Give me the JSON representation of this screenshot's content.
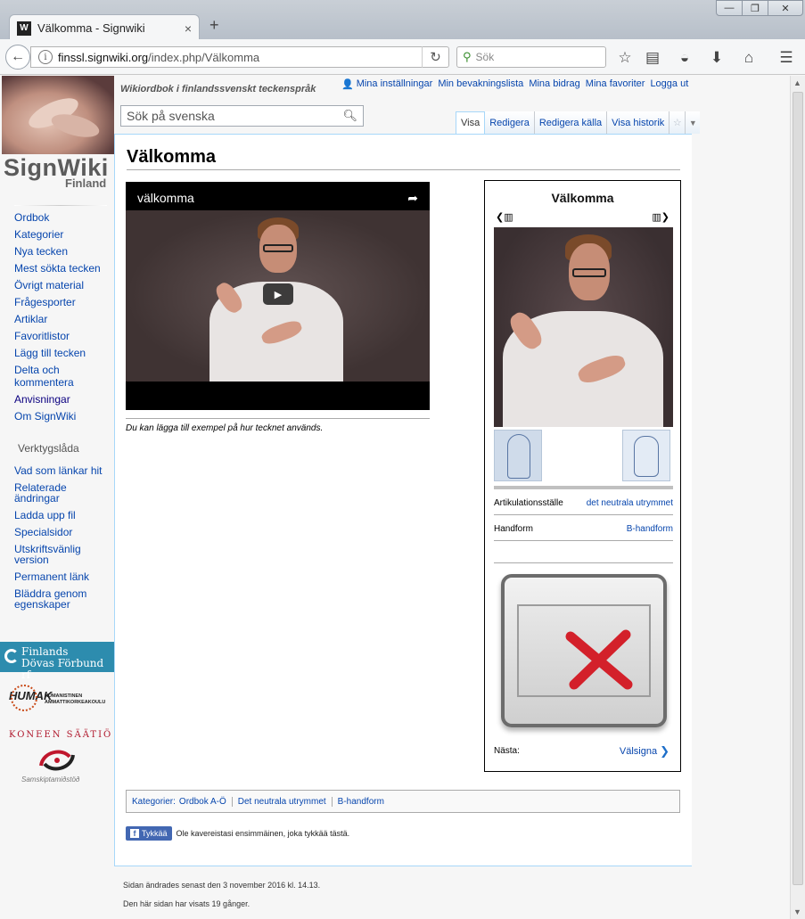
{
  "browser": {
    "tab_title": "Välkomma - Signwiki",
    "tab_close": "×",
    "new_tab": "+",
    "favicon": "W",
    "url_domain": "finssl.signwiki.org",
    "url_path": "/index.php/Välkomma",
    "search_placeholder": "Sök",
    "window_min": "—",
    "window_max": "❐",
    "window_close": "✕",
    "icons": [
      "bookmark-star-icon",
      "reading-list-icon",
      "pocket-icon",
      "download-icon",
      "home-icon",
      "menu-icon"
    ]
  },
  "site": {
    "logo_title": "SignWiki",
    "logo_sub": "Finland",
    "tagline": "Wikiordbok i finlandssvenskt teckenspråk"
  },
  "personal_links": [
    "Mina inställningar",
    "Min bevakningslista",
    "Mina bidrag",
    "Mina favoriter",
    "Logga ut"
  ],
  "search": {
    "placeholder": "Sök på svenska"
  },
  "tabs": [
    "Visa",
    "Redigera",
    "Redigera källa",
    "Visa historik"
  ],
  "sidebar": {
    "nav": [
      "Ordbok",
      "Kategorier",
      "Nya tecken",
      "Mest sökta tecken",
      "Övrigt material",
      "Frågesporter",
      "Artiklar",
      "Favoritlistor",
      "Lägg till tecken",
      "Delta och kommentera",
      "Anvisningar",
      "Om SignWiki"
    ],
    "tools_heading": "Verktygslåda",
    "tools": [
      "Vad som länkar hit",
      "Relaterade ändringar",
      "Ladda upp fil",
      "Specialsidor",
      "Utskriftsvänlig version",
      "Permanent länk",
      "Bläddra genom egenskaper"
    ],
    "partner1_line1": "Finlands",
    "partner1_line2": "Dövas Förbund rf",
    "partner2_name": "HUMAK",
    "partner2_line1": "HUMANISTINEN",
    "partner2_line2": "AMMATTIKORKEAKOULU",
    "partner3": "KONEEN SÄÄTIÖ",
    "partner4": "Samskiptamiðstöð"
  },
  "page": {
    "title": "Välkomma",
    "video_title": "välkomma",
    "video_caption": "Du kan lägga till exempel på hur tecknet används."
  },
  "infobox": {
    "title": "Välkomma",
    "rows": [
      {
        "key": "Artikulationsställe",
        "value": "det neutrala utrymmet"
      },
      {
        "key": "Handform",
        "value": "B-handform"
      }
    ],
    "next_label": "Nästa:",
    "next_value": "Välsigna"
  },
  "categories": {
    "label": "Kategorier:",
    "items": [
      "Ordbok A-Ö",
      "Det neutrala utrymmet",
      "B-handform"
    ]
  },
  "facebook": {
    "button": "Tykkää",
    "text": "Ole kavereistasi ensimmäinen, joka tykkää tästä."
  },
  "footer": {
    "last_modified": "Sidan ändrades senast den 3 november 2016 kl. 14.13.",
    "views": "Den här sidan har visats 19 gånger."
  },
  "colors": {
    "link": "#0645ad",
    "fdf_bar": "#2d8cae",
    "facebook": "#4267b2",
    "koneen": "#b0182c"
  }
}
